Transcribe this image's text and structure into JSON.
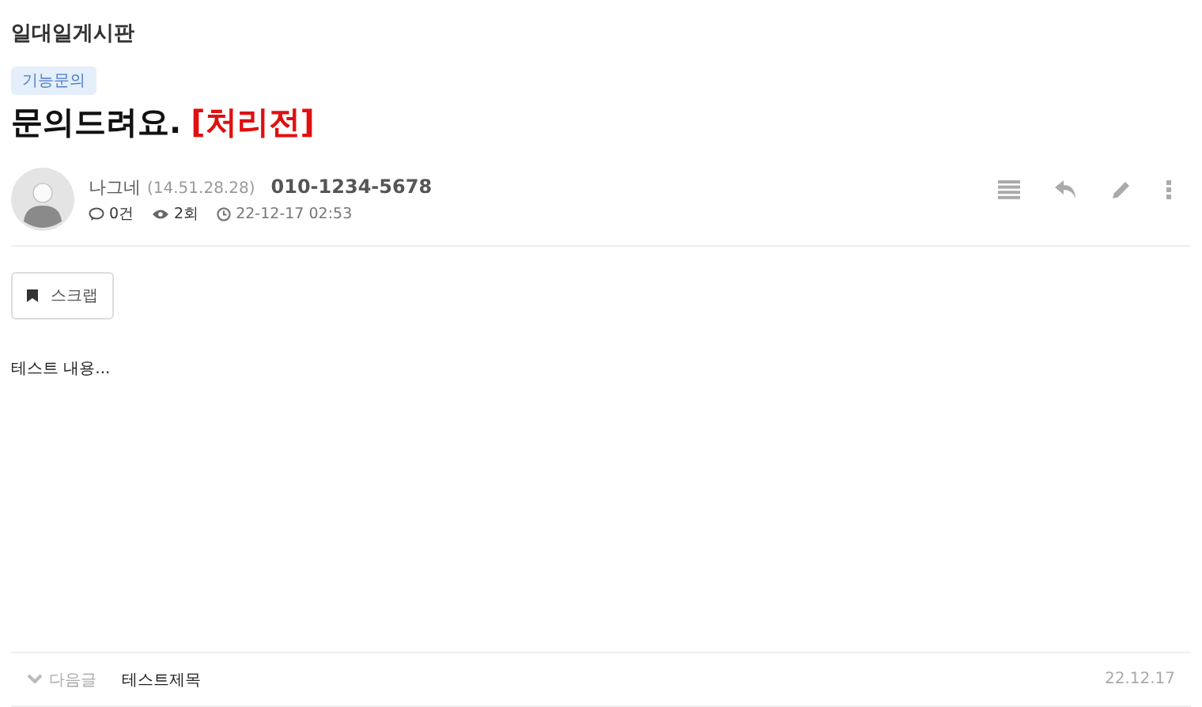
{
  "board_title": "일대일게시판",
  "category": "기능문의",
  "post": {
    "title": "문의드려요.",
    "status": "[처리전]"
  },
  "author": {
    "name": "나그네",
    "ip": "(14.51.28.28)",
    "phone": "010-1234-5678",
    "comments": "0건",
    "views": "2회",
    "date": "22-12-17 02:53"
  },
  "scrap_button": "스크랩",
  "content": "테스트 내용...",
  "next_post": {
    "label": "다음글",
    "title": "테스트제목",
    "date": "22.12.17"
  }
}
